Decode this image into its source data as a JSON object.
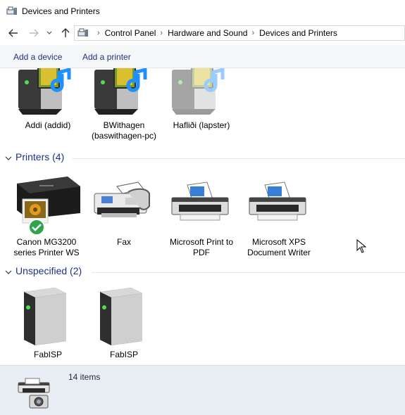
{
  "window": {
    "title": "Devices and Printers"
  },
  "address_bar": {
    "breadcrumbs": [
      "Control Panel",
      "Hardware and Sound",
      "Devices and Printers"
    ]
  },
  "commands": {
    "add_device": "Add a device",
    "add_printer": "Add a printer"
  },
  "devices": [
    {
      "label_line1": "Addi (addid)",
      "label_line2": "",
      "icon": "computer-media-icon",
      "faded": false
    },
    {
      "label_line1": "BWithagen",
      "label_line2": "(baswithagen-pc)",
      "icon": "computer-media-icon",
      "faded": false
    },
    {
      "label_line1": "Hafliði (lapster)",
      "label_line2": "",
      "icon": "computer-media-icon",
      "faded": true
    }
  ],
  "groups": {
    "printers": {
      "title": "Printers (4)"
    },
    "unspecified": {
      "title": "Unspecified (2)"
    }
  },
  "printers": [
    {
      "label_line1": "Canon MG3200",
      "label_line2": "series Printer WS",
      "icon": "canon-printer-icon",
      "default": true
    },
    {
      "label_line1": "Fax",
      "label_line2": "",
      "icon": "fax-icon",
      "default": false
    },
    {
      "label_line1": "Microsoft Print to",
      "label_line2": "PDF",
      "icon": "printer-icon",
      "default": false
    },
    {
      "label_line1": "Microsoft XPS",
      "label_line2": "Document Writer",
      "icon": "printer-icon",
      "default": false
    }
  ],
  "unspecified": [
    {
      "label_line1": "FabISP",
      "icon": "tower-icon"
    },
    {
      "label_line1": "FabISP",
      "icon": "tower-icon"
    }
  ],
  "status": {
    "items_count": "14 items"
  },
  "colors": {
    "link_blue": "#1e3287",
    "status_bar": "#e9eef4",
    "default_check": "#2ea44f"
  }
}
